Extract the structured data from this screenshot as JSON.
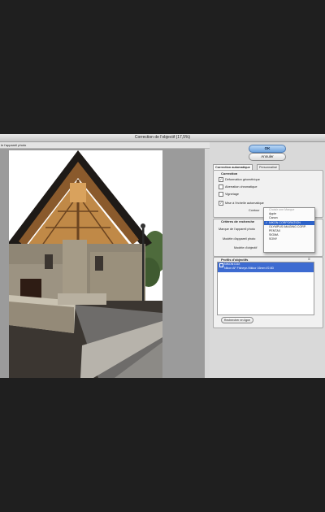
{
  "window": {
    "title": "Correction de l'objectif (17,5%)",
    "toolbar_text": "le l'appareil photo"
  },
  "buttons": {
    "ok": "OK",
    "cancel": "Annuler"
  },
  "tabs": [
    {
      "label": "Correction automatique",
      "active": true
    },
    {
      "label": "Personnalisé",
      "active": false
    }
  ],
  "correction": {
    "legend": "Correction",
    "options": [
      {
        "label": "Déformation géométrique",
        "checked": true
      },
      {
        "label": "Aberration chromatique",
        "checked": false
      },
      {
        "label": "Vignetage",
        "checked": false
      }
    ],
    "auto_scale": {
      "label": "Mise à l'échelle automatique",
      "checked": true
    },
    "contour_label": "Contour"
  },
  "search_criteria": {
    "legend": "Critères de recherche",
    "brand_label": "Marque de l'appareil photo",
    "model_label": "Modèle d'appareil photo",
    "lens_label": "Modèle d'objectif"
  },
  "brand_dropdown": {
    "items": [
      {
        "label": "Choisir une Marque",
        "state": "disabled"
      },
      {
        "label": "Apple",
        "state": "normal"
      },
      {
        "label": "Canon",
        "state": "normal"
      },
      {
        "label": "NIKON CORPORATION",
        "state": "selected"
      },
      {
        "label": "OLYMPUS IMAGING CORP.",
        "state": "normal"
      },
      {
        "label": "PENTAX",
        "state": "normal"
      },
      {
        "label": "SIGMA",
        "state": "normal"
      },
      {
        "label": "SONY",
        "state": "normal"
      }
    ]
  },
  "profiles": {
    "legend": "Profils d'objectifs",
    "items": [
      {
        "line1": "NIKON D3X",
        "line2": "Nikon AF Fisheye-Nikkor 16mm f/2.8D",
        "selected": true
      }
    ],
    "search_online": "Rechercher en ligne"
  },
  "colors": {
    "background": "#1f1f1f",
    "selection": "#3d6bd1",
    "primary_button": "#6ea3dd"
  }
}
